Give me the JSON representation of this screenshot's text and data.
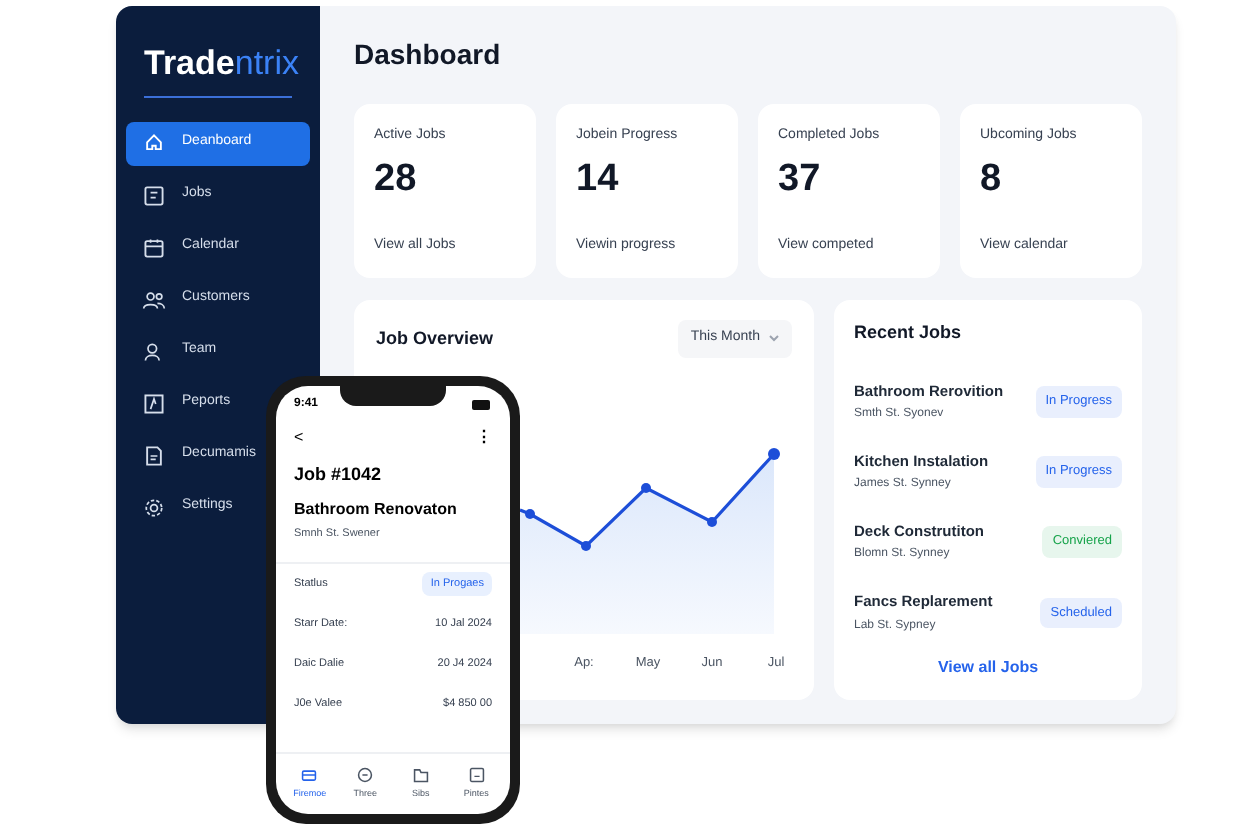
{
  "logo": {
    "main": "Trade",
    "accent": "ntrix"
  },
  "sidebar": {
    "items": [
      {
        "label": "Deanboard",
        "selected": true
      },
      {
        "label": "Jobs",
        "selected": false
      },
      {
        "label": "Calendar",
        "selected": false
      },
      {
        "label": "Customers",
        "selected": false
      },
      {
        "label": "Team",
        "selected": false
      },
      {
        "label": "Peports",
        "selected": false
      },
      {
        "label": "Decumamis",
        "selected": false
      },
      {
        "label": "Settings",
        "selected": false
      }
    ]
  },
  "page_title": "Dashboard",
  "stats": [
    {
      "label": "Active Jobs",
      "value": "28",
      "link": "View all Jobs"
    },
    {
      "label": "Jobein Progress",
      "value": "14",
      "link": "Viewin progress"
    },
    {
      "label": "Completed Jobs",
      "value": "37",
      "link": "View competed"
    },
    {
      "label": "Ubcoming Jobs",
      "value": "8",
      "link": "View calendar"
    }
  ],
  "job_overview": {
    "title": "Job Overview",
    "period": "This Month",
    "x_labels": [
      "Ap:",
      "May",
      "Jun",
      "Jul"
    ]
  },
  "recent_jobs": {
    "title": "Recent Jobs",
    "items": [
      {
        "title": "Bathroom Rerovition",
        "address": "Smth St. Syonev",
        "status": "In Progress",
        "color": "#2563eb"
      },
      {
        "title": "Kitchen Instalation",
        "address": "James St. Synney",
        "status": "In Progress",
        "color": "#2563eb"
      },
      {
        "title": "Deck Construtiton",
        "address": "Blomn St. Synney",
        "status": "Conviered",
        "color": "#16a34a"
      },
      {
        "title": "Fancs Replarement",
        "address": "Lab St. Sypney",
        "status": "Scheduled",
        "color": "#2563eb"
      }
    ],
    "link": "View all Jobs"
  },
  "phone": {
    "time": "9:41",
    "back": "<",
    "more": "⋮",
    "job_number": "Job #1042",
    "job_title": "Bathroom Renovaton",
    "address": "Smnh St. Swener",
    "details": [
      {
        "kind": "badge",
        "label": "Statlus",
        "value": "In Progaes"
      },
      {
        "kind": "text",
        "label": "Starr Date:",
        "value": "10 Jal 2024"
      },
      {
        "kind": "text",
        "label": "Daic Dalie",
        "value": "20 J4 2024"
      },
      {
        "kind": "text",
        "label": "J0e Valee",
        "value": "$4 850 00"
      }
    ],
    "tabs": [
      {
        "label": "Firemoe",
        "selected": true
      },
      {
        "label": "Three",
        "selected": false
      },
      {
        "label": "Sibs",
        "selected": false
      },
      {
        "label": "Pintes",
        "selected": false
      }
    ]
  }
}
